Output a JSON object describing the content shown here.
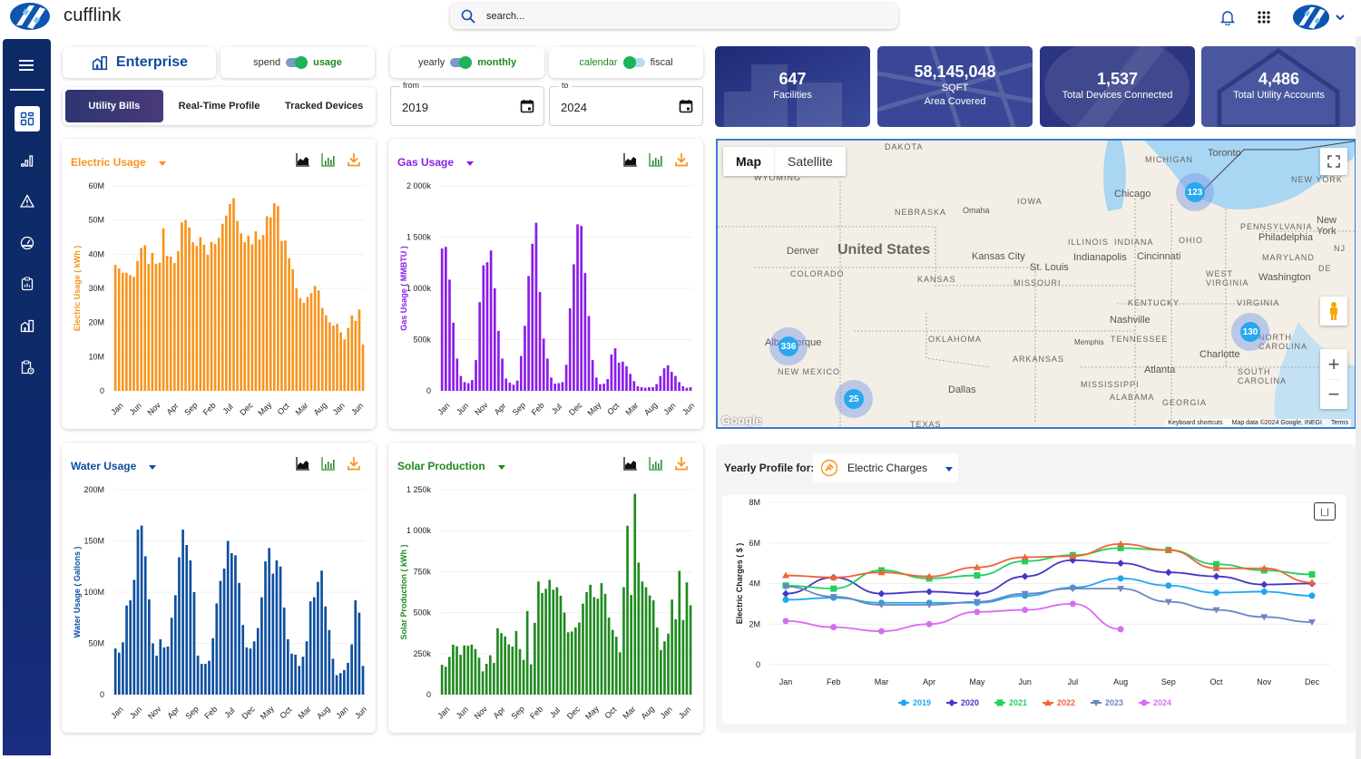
{
  "app": {
    "name": "cufflink"
  },
  "search": {
    "placeholder": "search..."
  },
  "header_icons": [
    "bell-icon",
    "apps-grid-icon",
    "avatar",
    "chevron-down-icon"
  ],
  "sidebar": {
    "items": [
      {
        "name": "dashboard",
        "icon": "dashboard-icon",
        "active": true
      },
      {
        "name": "analytics",
        "icon": "signal-bars-icon"
      },
      {
        "name": "alerts",
        "icon": "warning-icon"
      },
      {
        "name": "gauge",
        "icon": "gauge-icon"
      },
      {
        "name": "reports",
        "icon": "clipboard-chart-icon"
      },
      {
        "name": "facilities",
        "icon": "building-icon"
      },
      {
        "name": "schedule",
        "icon": "clipboard-clock-icon"
      }
    ]
  },
  "controls": {
    "enterprise_label": "Enterprise",
    "spend_usage": {
      "left": "spend",
      "right": "usage",
      "selected": "usage"
    },
    "yearly_monthly": {
      "left": "yearly",
      "right": "monthly",
      "selected": "monthly"
    },
    "calendar_fiscal": {
      "left": "calendar",
      "right": "fiscal",
      "selected": "calendar"
    },
    "tabs": [
      {
        "label": "Utility Bills",
        "active": true
      },
      {
        "label": "Real-Time Profile",
        "active": false
      },
      {
        "label": "Tracked Devices",
        "active": false
      }
    ],
    "from": {
      "label": "from",
      "value": "2019"
    },
    "to": {
      "label": "to",
      "value": "2024"
    }
  },
  "stats": [
    {
      "value": "647",
      "label": "Facilities",
      "label2": ""
    },
    {
      "value": "58,145,048",
      "label": "SQFT",
      "label2": "Area Covered"
    },
    {
      "value": "1,537",
      "label": "Total Devices Connected",
      "label2": ""
    },
    {
      "value": "4,486",
      "label": "Total Utility Accounts",
      "label2": ""
    }
  ],
  "map": {
    "type_buttons": [
      "Map",
      "Satellite"
    ],
    "active_type": "Map",
    "clusters": [
      {
        "count": "336",
        "near": "Albuquerque"
      },
      {
        "count": "25",
        "near": "West Texas"
      },
      {
        "count": "123",
        "near": "Detroit"
      },
      {
        "count": "130",
        "near": "North Carolina"
      }
    ],
    "labels": {
      "country": "United States",
      "states": [
        "DAKOTA",
        "WYOMING",
        "NEBRASKA",
        "IOWA",
        "COLORADO",
        "KANSAS",
        "MISSOURI",
        "OKLAHOMA",
        "NEW MEXICO",
        "ARKANSAS",
        "TEXAS",
        "MICHIGAN",
        "ILLINOIS",
        "INDIANA",
        "OHIO",
        "KENTUCKY",
        "TENNESSEE",
        "MISSISSIPPI",
        "ALABAMA",
        "GEORGIA",
        "PENNSYLVANIA",
        "NEW YORK",
        "WEST VIRGINIA",
        "VIRGINIA",
        "MARYLAND",
        "NORTH CAROLINA",
        "SOUTH CAROLINA",
        "NJ",
        "DE"
      ],
      "cities": [
        "Denver",
        "Omaha",
        "Kansas City",
        "St. Louis",
        "Albuquerque",
        "Dallas",
        "Chicago",
        "Indianapolis",
        "Cincinnati",
        "Nashville",
        "Memphis",
        "Atlanta",
        "Charlotte",
        "Washington",
        "Philadelphia",
        "New York",
        "Toronto"
      ]
    },
    "footer": [
      "Keyboard shortcuts",
      "Map data ©2024 Google, INEGI",
      "Terms"
    ],
    "google": "Google"
  },
  "profile": {
    "header": "Yearly Profile for:",
    "selected": "Electric Charges",
    "reset_label": "|_|"
  },
  "tool_icons": [
    "area-chart-icon",
    "bar-chart-icon",
    "download-icon"
  ],
  "chart_data": [
    {
      "id": "electric",
      "type": "bar",
      "title": "Electric Usage",
      "color": "#f7941d",
      "ylabel": "Electric Usage ( kWh )",
      "xlabel": "",
      "ylim": [
        0,
        60000000
      ],
      "yticks": [
        "0",
        "10M",
        "20M",
        "30M",
        "40M",
        "50M",
        "60M"
      ],
      "xticks": [
        "Jan",
        "Jun",
        "Nov",
        "Apr",
        "Sep",
        "Feb",
        "Jul",
        "Dec",
        "May",
        "Oct",
        "Mar",
        "Aug",
        "Jan",
        "Jun"
      ],
      "start": "2019-01",
      "values": [
        36.9,
        35.8,
        34.6,
        34.6,
        33.9,
        33.4,
        38.0,
        41.8,
        42.6,
        37.2,
        40.4,
        37.2,
        37.5,
        47.6,
        39.5,
        39.3,
        37.4,
        40.9,
        49.3,
        50.0,
        47.8,
        43.5,
        42.4,
        45.0,
        42.8,
        39.8,
        43.6,
        43.0,
        44.8,
        48.9,
        51.3,
        54.7,
        56.4,
        49.7,
        46.1,
        43.5,
        45.4,
        42.9,
        46.7,
        44.3,
        45.6,
        51.1,
        50.8,
        54.9,
        54.1,
        43.9,
        44.0,
        38.8,
        35.6,
        30.0,
        27.2,
        25.8,
        27.5,
        28.6,
        30.7,
        29.4,
        24.3,
        22.1,
        20.0,
        19.1,
        19.6,
        17.1,
        15.1,
        18.4,
        22.1,
        20.5,
        23.8,
        13.6
      ]
    },
    {
      "id": "gas",
      "type": "bar",
      "title": "Gas Usage",
      "color": "#8b1ee8",
      "ylabel": "Gas Usage ( MMBTU )",
      "xlabel": "",
      "ylim": [
        0,
        2000000
      ],
      "yticks": [
        "0",
        "500k",
        "1 000k",
        "1 500k",
        "2 000k"
      ],
      "xticks": [
        "Jan",
        "Jun",
        "Nov",
        "Apr",
        "Sep",
        "Feb",
        "Jul",
        "Dec",
        "May",
        "Oct",
        "Mar",
        "Aug",
        "Jan",
        "Jun"
      ],
      "start": "2019-01",
      "values": [
        1390,
        1405,
        1085,
        665,
        315,
        145,
        85,
        75,
        105,
        300,
        865,
        1225,
        1255,
        1370,
        1000,
        585,
        315,
        120,
        80,
        60,
        100,
        340,
        635,
        1120,
        1435,
        1640,
        965,
        510,
        315,
        130,
        70,
        75,
        85,
        255,
        805,
        1235,
        1625,
        1610,
        1150,
        730,
        300,
        130,
        65,
        70,
        115,
        355,
        415,
        275,
        285,
        240,
        165,
        95,
        45,
        35,
        30,
        35,
        35,
        65,
        145,
        220,
        250,
        185,
        145,
        85,
        45,
        30,
        35
      ]
    },
    {
      "id": "water",
      "type": "bar",
      "title": "Water Usage",
      "color": "#0d4fa0",
      "ylabel": "Water Usage ( Gallons )",
      "xlabel": "",
      "ylim": [
        0,
        200000000
      ],
      "yticks": [
        "0",
        "50M",
        "100M",
        "150M",
        "200M"
      ],
      "xticks": [
        "Jan",
        "Jun",
        "Nov",
        "Apr",
        "Sep",
        "Feb",
        "Jul",
        "Dec",
        "May",
        "Oct",
        "Mar",
        "Aug",
        "Jan",
        "Jun"
      ],
      "start": "2019-01",
      "values": [
        45,
        41,
        51,
        87,
        92,
        112,
        161,
        165,
        135,
        93,
        50,
        38,
        54,
        46,
        47,
        75,
        97,
        134,
        161,
        146,
        131,
        100,
        38,
        30,
        30,
        33,
        55,
        89,
        111,
        123,
        150,
        138,
        136,
        109,
        68,
        46,
        45,
        52,
        65,
        95,
        130,
        143,
        118,
        131,
        125,
        85,
        54,
        40,
        39,
        28,
        37,
        52,
        91,
        95,
        110,
        121,
        86,
        63,
        35,
        19,
        21,
        24,
        31,
        49,
        92,
        80,
        28
      ]
    },
    {
      "id": "solar",
      "type": "bar",
      "title": "Solar Production",
      "color": "#1f8a1f",
      "ylabel": "Solar Production ( kWh )",
      "xlabel": "",
      "ylim": [
        0,
        1250000
      ],
      "yticks": [
        "0",
        "250k",
        "500k",
        "750k",
        "1 000k",
        "1 250k"
      ],
      "xticks": [
        "Jan",
        "Jun",
        "Nov",
        "Apr",
        "Sep",
        "Feb",
        "Jul",
        "Dec",
        "May",
        "Oct",
        "Mar",
        "Aug",
        "Jan",
        "Jun"
      ],
      "start": "2019-01",
      "values": [
        182,
        170,
        230,
        305,
        295,
        243,
        300,
        298,
        305,
        278,
        225,
        142,
        188,
        240,
        193,
        405,
        375,
        355,
        307,
        293,
        388,
        278,
        212,
        510,
        185,
        438,
        690,
        620,
        645,
        700,
        640,
        655,
        603,
        500,
        380,
        385,
        410,
        440,
        555,
        625,
        670,
        595,
        585,
        680,
        615,
        470,
        395,
        353,
        258,
        655,
        1030,
        608,
        1225,
        805,
        690,
        655,
        605,
        575,
        410,
        272,
        325,
        372,
        580,
        460,
        755,
        455,
        685,
        545
      ]
    },
    {
      "id": "electric-charges-profile",
      "type": "line",
      "title": "Yearly Profile for: Electric Charges",
      "xlabel": "",
      "ylabel": "Electric Charges ( $ )",
      "ylim": [
        0,
        8000000
      ],
      "yticks": [
        "0",
        "2M",
        "4M",
        "6M",
        "8M"
      ],
      "categories": [
        "Jan",
        "Feb",
        "Mar",
        "Apr",
        "May",
        "Jun",
        "Jul",
        "Aug",
        "Sep",
        "Oct",
        "Nov",
        "Dec"
      ],
      "legend": "bottom",
      "series": [
        {
          "name": "2019",
          "color": "#1ea7f0",
          "marker": "circle",
          "values": [
            3.2,
            3.3,
            3.05,
            3.05,
            3.05,
            3.4,
            3.8,
            4.25,
            3.9,
            3.55,
            3.6,
            3.4
          ]
        },
        {
          "name": "2020",
          "color": "#4636c8",
          "marker": "diamond",
          "values": [
            3.5,
            4.3,
            3.5,
            3.6,
            3.5,
            4.35,
            5.15,
            5.0,
            4.55,
            4.35,
            3.95,
            4.0
          ]
        },
        {
          "name": "2021",
          "color": "#22d05f",
          "marker": "square",
          "values": [
            3.9,
            3.75,
            4.65,
            4.25,
            4.4,
            5.1,
            5.4,
            5.75,
            5.65,
            4.95,
            4.65,
            4.45
          ]
        },
        {
          "name": "2022",
          "color": "#f26335",
          "marker": "triangle",
          "values": [
            4.4,
            4.3,
            4.55,
            4.35,
            4.8,
            5.3,
            5.35,
            5.95,
            5.65,
            4.75,
            4.75,
            4.05
          ]
        },
        {
          "name": "2023",
          "color": "#6b86c2",
          "marker": "triangle-down",
          "values": [
            3.85,
            3.35,
            2.95,
            2.95,
            3.1,
            3.5,
            3.75,
            3.75,
            3.1,
            2.7,
            2.35,
            2.1
          ]
        },
        {
          "name": "2024",
          "color": "#d86cf0",
          "marker": "circle",
          "values": [
            2.15,
            1.85,
            1.65,
            2.0,
            2.6,
            2.7,
            3.0,
            1.75
          ]
        }
      ]
    }
  ]
}
